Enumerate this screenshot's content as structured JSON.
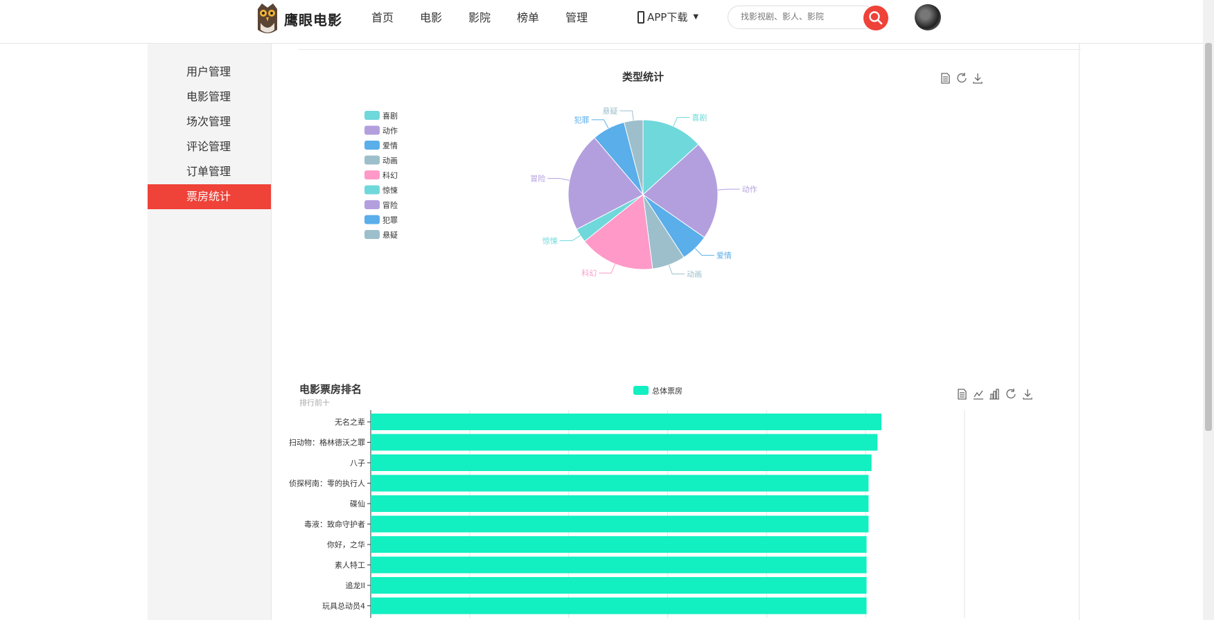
{
  "header": {
    "brand": "鹰眼电影",
    "nav": [
      "首页",
      "电影",
      "影院",
      "榜单",
      "管理"
    ],
    "app_download": "APP下载",
    "search_placeholder": "找影视剧、影人、影院"
  },
  "sidebar": {
    "items": [
      {
        "label": "用户管理",
        "active": false
      },
      {
        "label": "电影管理",
        "active": false
      },
      {
        "label": "场次管理",
        "active": false
      },
      {
        "label": "评论管理",
        "active": false
      },
      {
        "label": "订单管理",
        "active": false
      },
      {
        "label": "票房统计",
        "active": true
      }
    ]
  },
  "colors": {
    "accent": "#ef4238",
    "bar": "#12efc1"
  },
  "icons": [
    "logo-icon",
    "phone-icon",
    "search-icon",
    "data-view-icon",
    "line-chart-icon",
    "bar-chart-icon",
    "refresh-icon",
    "download-icon"
  ],
  "chart_data": [
    {
      "type": "pie",
      "title": "类型统计",
      "legend_position": "left",
      "labels": [
        "喜剧",
        "动作",
        "爱情",
        "动画",
        "科幻",
        "惊悚",
        "冒险",
        "犯罪",
        "悬疑"
      ],
      "values": [
        13,
        21,
        6,
        7,
        16,
        3,
        21,
        7,
        4
      ],
      "colors": [
        "#6fd8db",
        "#b39fde",
        "#5aaeea",
        "#9cbfcb",
        "#ff99c8",
        "#6fd8db",
        "#b39fde",
        "#5aaeea",
        "#9cbfcb"
      ]
    },
    {
      "type": "bar",
      "orientation": "horizontal",
      "title": "电影票房排名",
      "subtitle": "排行前十",
      "legend": "总体票房",
      "grid": true,
      "categories": [
        "无名之辈",
        "扫动物：格林德沃之罪",
        "八子",
        "侦探柯南：零的执行人",
        "碟仙",
        "毒液：致命守护者",
        "你好，之华",
        "素人特工",
        "追龙II",
        "玩具总动员4"
      ],
      "values": [
        51.6,
        51.2,
        50.6,
        50.3,
        50.3,
        50.3,
        50.1,
        50.1,
        50.1,
        50.1
      ],
      "xlim": [
        0,
        60
      ]
    }
  ]
}
